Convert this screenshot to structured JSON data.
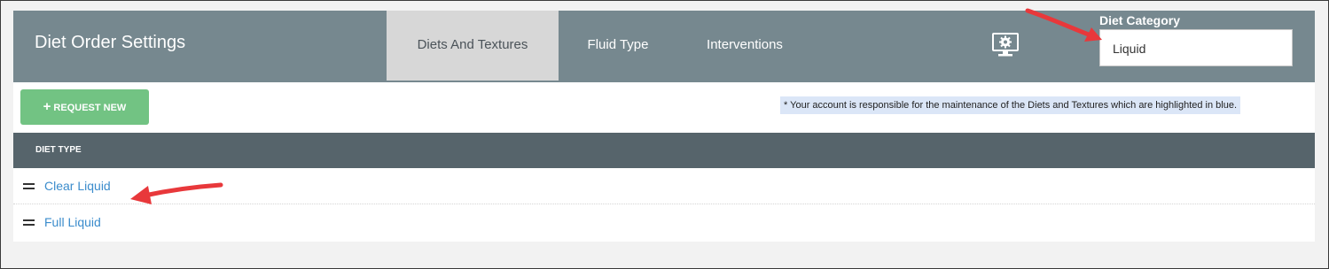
{
  "header": {
    "title": "Diet Order Settings",
    "tabs": [
      {
        "label": "Diets And Textures",
        "active": true
      },
      {
        "label": "Fluid Type",
        "active": false
      },
      {
        "label": "Interventions",
        "active": false
      }
    ],
    "settings_icon": "monitor-gear-icon",
    "diet_category": {
      "label": "Diet Category",
      "value": "Liquid"
    }
  },
  "toolbar": {
    "request_new_label": "REQUEST NEW",
    "request_new_icon": "+",
    "note": "* Your account is responsible for the maintenance of the Diets and Textures which are highlighted in blue."
  },
  "table": {
    "column_header": "DIET TYPE",
    "rows": [
      {
        "label": "Clear Liquid"
      },
      {
        "label": "Full Liquid"
      }
    ]
  },
  "colors": {
    "header_bg": "#76888f",
    "active_tab_bg": "#d7d7d7",
    "table_header_bg": "#56646b",
    "request_button_bg": "#72c383",
    "link_color": "#3b8ccc",
    "note_highlight": "#dbe6f7",
    "annotation_arrow": "#e8383b"
  }
}
